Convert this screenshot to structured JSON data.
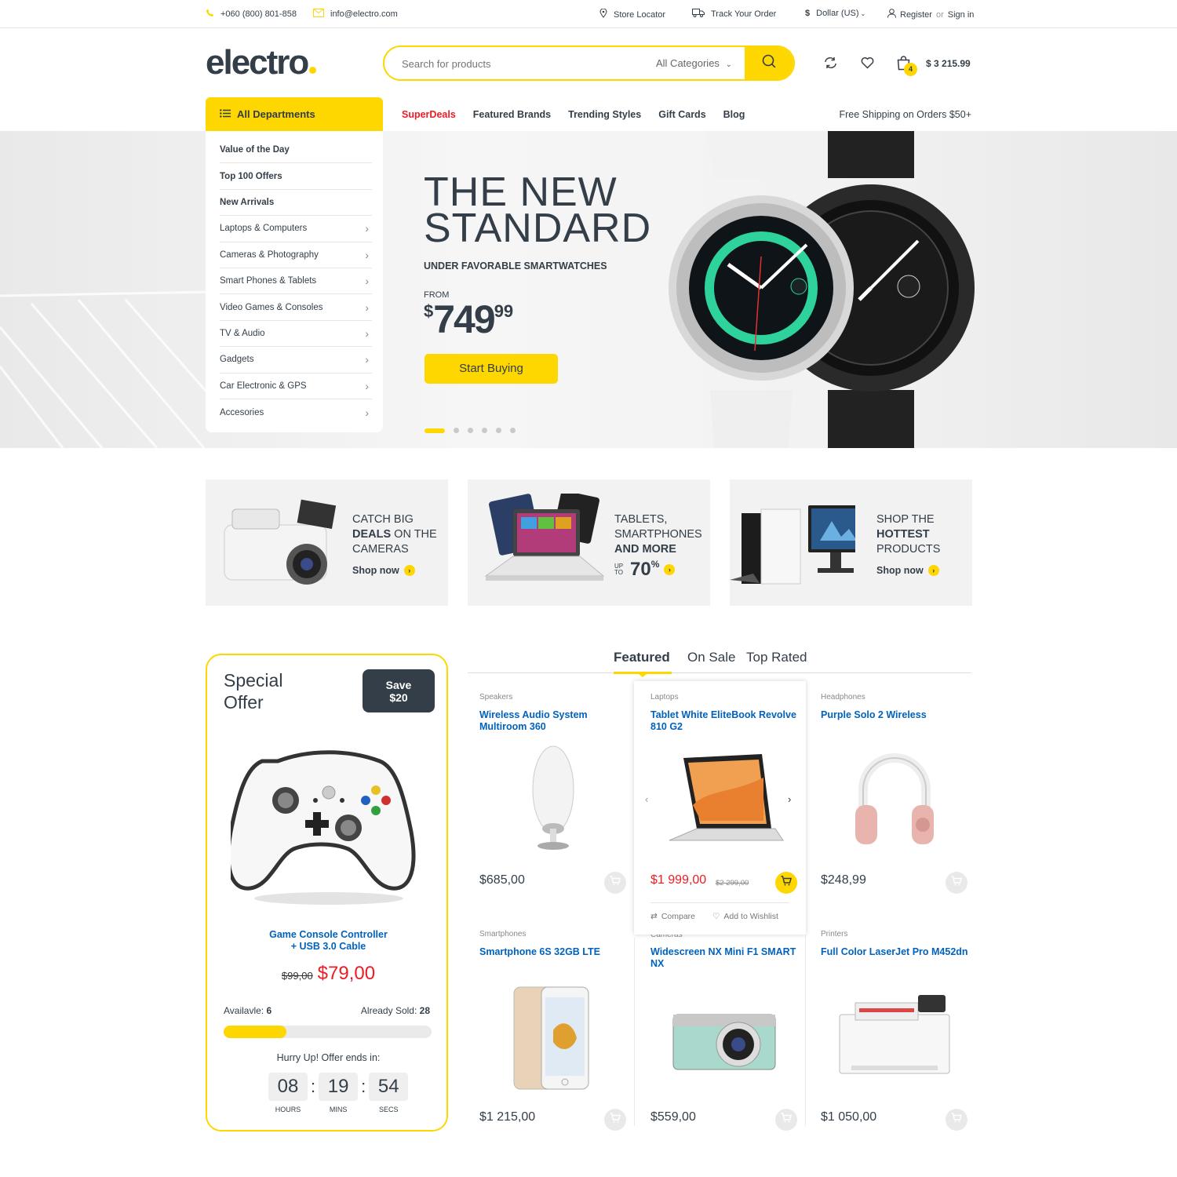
{
  "topbar": {
    "phone": "+060 (800) 801-858",
    "email": "info@electro.com",
    "store_locator": "Store Locator",
    "track_order": "Track Your Order",
    "currency": "Dollar (US)",
    "register": "Register",
    "or": "or",
    "signin": "Sign in"
  },
  "header": {
    "logo": "electro",
    "search_placeholder": "Search for products",
    "category_select": "All Categories",
    "cart_count": "4",
    "cart_total": "$ 3 215.99"
  },
  "nav": {
    "all_departments": "All Departments",
    "links": [
      "SuperDeals",
      "Featured Brands",
      "Trending Styles",
      "Gift Cards",
      "Blog"
    ],
    "free_shipping": "Free Shipping on Orders $50+"
  },
  "departments": [
    {
      "label": "Value of the Day",
      "bold": true
    },
    {
      "label": "Top 100 Offers",
      "bold": true
    },
    {
      "label": "New Arrivals",
      "bold": true
    },
    {
      "label": "Laptops & Computers"
    },
    {
      "label": "Cameras & Photography"
    },
    {
      "label": "Smart Phones & Tablets"
    },
    {
      "label": "Video Games & Consoles"
    },
    {
      "label": "TV & Audio"
    },
    {
      "label": "Gadgets"
    },
    {
      "label": "Car Electronic & GPS"
    },
    {
      "label": "Accesories"
    }
  ],
  "hero": {
    "title_line1": "THE NEW",
    "title_line2": "STANDARD",
    "subtitle": "UNDER FAVORABLE SMARTWATCHES",
    "from": "FROM",
    "price_symbol": "$",
    "price_main": "749",
    "price_cents": "99",
    "cta": "Start Buying",
    "slide_count": 6,
    "active_slide": 1
  },
  "banners": [
    {
      "l1": "CATCH BIG",
      "l2b": "DEALS",
      "l2": " ON THE",
      "l3": "CAMERAS",
      "shop": "Shop now"
    },
    {
      "l1": "TABLETS,",
      "l2": "SMARTPHONES",
      "l3b": "AND MORE",
      "upto": "UP TO",
      "pct": "70",
      "pct_sign": "%"
    },
    {
      "l1": "SHOP THE",
      "l2b": "HOTTEST",
      "l3": "PRODUCTS",
      "shop": "Shop now"
    }
  ],
  "special": {
    "title1": "Special",
    "title2": "Offer",
    "save1": "Save",
    "save2": "$20",
    "name1": "Game Console Controller",
    "name2": "+ USB 3.0 Cable",
    "old_price": "$99,00",
    "new_price": "$79,00",
    "available_label": "Availavle:",
    "available": "6",
    "sold_label": "Already Sold:",
    "sold": "28",
    "sold_fraction": 0.3,
    "hurry": "Hurry Up! Offer ends in:",
    "hours": "08",
    "mins": "19",
    "secs": "54",
    "hours_label": "HOURS",
    "mins_label": "MINS",
    "secs_label": "SECS"
  },
  "tabs": [
    "Featured",
    "On Sale",
    "Top Rated"
  ],
  "products": [
    {
      "cat": "Speakers",
      "name": "Wireless Audio System Multiroom 360",
      "price": "$685,00"
    },
    {
      "cat": "Laptops",
      "name": "Tablet White EliteBook Revolve 810 G2",
      "price": "$1 999,00",
      "old": "$2 299,00",
      "compare": "Compare",
      "wishlist": "Add to Wishlist"
    },
    {
      "cat": "Headphones",
      "name": "Purple Solo 2 Wireless",
      "price": "$248,99"
    },
    {
      "cat": "Smartphones",
      "name": "Smartphone 6S 32GB LTE",
      "price": "$1 215,00"
    },
    {
      "cat": "Cameras",
      "name": "Widescreen NX Mini F1 SMART NX",
      "price": "$559,00"
    },
    {
      "cat": "Printers",
      "name": "Full Color LaserJet Pro M452dn",
      "price": "$1 050,00"
    }
  ],
  "colors": {
    "accent": "#fed700",
    "text": "#333e48",
    "link": "#0062bd",
    "sale": "#ed1c24"
  }
}
